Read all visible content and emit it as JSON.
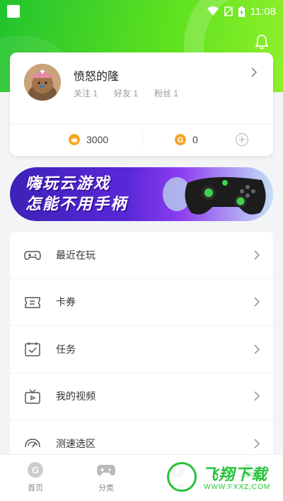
{
  "status_bar": {
    "time": "11:08"
  },
  "profile": {
    "username": "愤怒的隆",
    "following_label": "关注 1",
    "friends_label": "好友 1",
    "fans_label": "粉丝 1",
    "coins": "3000",
    "g_coins": "0"
  },
  "banner": {
    "line1": "嗨玩云游戏",
    "line2": "怎能不用手柄"
  },
  "menu": {
    "items": [
      {
        "label": "最近在玩",
        "icon": "gamepad-icon"
      },
      {
        "label": "卡券",
        "icon": "ticket-icon"
      },
      {
        "label": "任务",
        "icon": "task-icon"
      },
      {
        "label": "我的视频",
        "icon": "tv-icon"
      },
      {
        "label": "测速选区",
        "icon": "speedometer-icon"
      }
    ]
  },
  "tabbar": {
    "tabs": [
      {
        "label": "首页"
      },
      {
        "label": "分类"
      },
      {
        "label": "发现"
      },
      {
        "label": "我的"
      }
    ]
  },
  "watermark": {
    "name": "飞翔下载",
    "url": "WWW.FXXZ.COM"
  },
  "colors": {
    "accent": "#27c23a",
    "coin": "#f5a623"
  }
}
